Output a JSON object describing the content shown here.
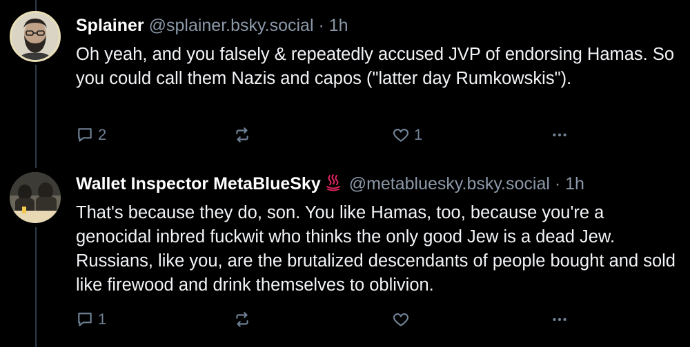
{
  "posts": [
    {
      "author": "Splainer",
      "handle": "@splainer.bsky.social",
      "separator": "·",
      "time": "1h",
      "text": "Oh yeah, and you falsely & repeatedly accused JVP of endorsing Hamas. So you could call them Nazis and capos (\"latter day Rumkowskis\").",
      "replies": "2",
      "reposts": "",
      "likes": "1",
      "avatar_icon": "bearded-man-portrait"
    },
    {
      "author": "Wallet Inspector MetaBlueSky",
      "author_emoji_icon": "hot-springs-icon",
      "handle": "@metabluesky.bsky.social",
      "separator": "·",
      "time": "1h",
      "text": "That's because they do, son. You like Hamas, too, because you're a genocidal inbred fuckwit who thinks the only good Jew is a dead Jew. Russians, like you, are the brutalized descendants of people bought and sold like firewood and drink themselves to oblivion.",
      "replies": "1",
      "reposts": "",
      "likes": "",
      "avatar_icon": "group-photo"
    }
  ],
  "colors": {
    "background": "#000000",
    "muted_text": "#8b98a8",
    "icon": "#6f8194",
    "thread_line": "#2e3b47",
    "flame": "#e0245e"
  },
  "icons": {
    "reply": "reply-bubble-icon",
    "repost": "repost-arrows-icon",
    "like": "heart-icon",
    "more": "more-dots-icon"
  }
}
